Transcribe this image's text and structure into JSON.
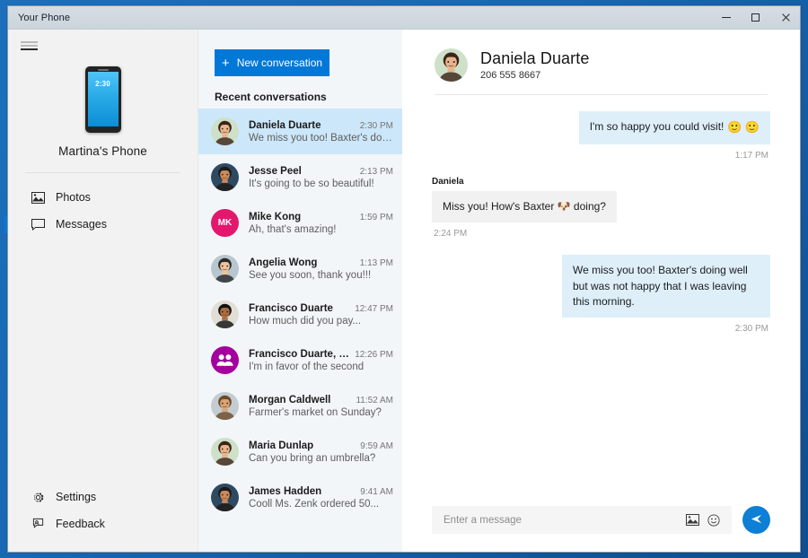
{
  "window": {
    "title": "Your Phone",
    "controls": {
      "minimize": "Minimize",
      "maximize": "Maximize",
      "close": "Close"
    }
  },
  "sidebar": {
    "menu_button": "Menu",
    "device": {
      "name": "Martina's Phone",
      "phone_clock": "2:30"
    },
    "items": [
      {
        "label": "Photos",
        "icon": "photos-icon",
        "selected": false
      },
      {
        "label": "Messages",
        "icon": "message-icon",
        "selected": true
      }
    ],
    "bottom_items": [
      {
        "label": "Settings",
        "icon": "gear-icon"
      },
      {
        "label": "Feedback",
        "icon": "feedback-icon"
      }
    ]
  },
  "conversations_pane": {
    "new_conversation_label": "New conversation",
    "new_conversation_plus": "+",
    "recent_label": "Recent conversations",
    "items": [
      {
        "name": "Daniela Duarte",
        "time": "2:30 PM",
        "snippet": "We miss you too! Baxter's doing ...",
        "active": true,
        "avatar_type": "photo",
        "avatar_color": "#c7b299",
        "initials": ""
      },
      {
        "name": "Jesse Peel",
        "time": "2:13 PM",
        "snippet": "It's going to be so beautiful!",
        "active": false,
        "avatar_type": "photo",
        "avatar_color": "#2e4a63",
        "initials": ""
      },
      {
        "name": "Mike Kong",
        "time": "1:59 PM",
        "snippet": "Ah, that's amazing!",
        "active": false,
        "avatar_type": "initials",
        "avatar_color": "#e3176e",
        "initials": "MK"
      },
      {
        "name": "Angelia Wong",
        "time": "1:13 PM",
        "snippet": "See you soon, thank you!!!",
        "active": false,
        "avatar_type": "photo",
        "avatar_color": "#3a3a3a",
        "initials": ""
      },
      {
        "name": "Francisco Duarte",
        "time": "12:47 PM",
        "snippet": "How much did you pay...",
        "active": false,
        "avatar_type": "photo",
        "avatar_color": "#8c6a52",
        "initials": ""
      },
      {
        "name": "Francisco Duarte, Dani...",
        "time": "12:26 PM",
        "snippet": "I'm in favor of the second",
        "active": false,
        "avatar_type": "group",
        "avatar_color": "#a4009e",
        "initials": ""
      },
      {
        "name": "Morgan Caldwell",
        "time": "11:52 AM",
        "snippet": "Farmer's market on Sunday?",
        "active": false,
        "avatar_type": "photo",
        "avatar_color": "#b3b8bd",
        "initials": ""
      },
      {
        "name": "Maria Dunlap",
        "time": "9:59 AM",
        "snippet": "Can you bring an umbrella?",
        "active": false,
        "avatar_type": "photo",
        "avatar_color": "#d8c3b0",
        "initials": ""
      },
      {
        "name": "James Hadden",
        "time": "9:41 AM",
        "snippet": "Cooll Ms. Zenk ordered 50...",
        "active": false,
        "avatar_type": "photo",
        "avatar_color": "#6b4a36",
        "initials": ""
      }
    ]
  },
  "chat": {
    "contact_name": "Daniela Duarte",
    "contact_phone": "206 555 8667",
    "messages": [
      {
        "direction": "out",
        "sender": "",
        "text": "I'm so happy you could visit!",
        "emoji": "🙂 🙂",
        "time": "1:17 PM"
      },
      {
        "direction": "in",
        "sender": "Daniela",
        "text": "Miss you! How's Baxter 🐶 doing?",
        "emoji": "",
        "time": "2:24 PM"
      },
      {
        "direction": "out",
        "sender": "",
        "text": "We miss you too! Baxter's doing well but was not happy that I was leaving this morning.",
        "emoji": "",
        "time": "2:30 PM"
      }
    ],
    "composer": {
      "placeholder": "Enter a message",
      "value": "",
      "image_icon": "image-icon",
      "emoji_icon": "emoji-icon",
      "send_icon": "send-icon"
    }
  },
  "colors": {
    "accent": "#0078d7",
    "selected_row": "#cce7f9",
    "out_bubble": "#deeffa",
    "in_bubble": "#f1f1f1",
    "send_button": "#0d7fd4"
  }
}
